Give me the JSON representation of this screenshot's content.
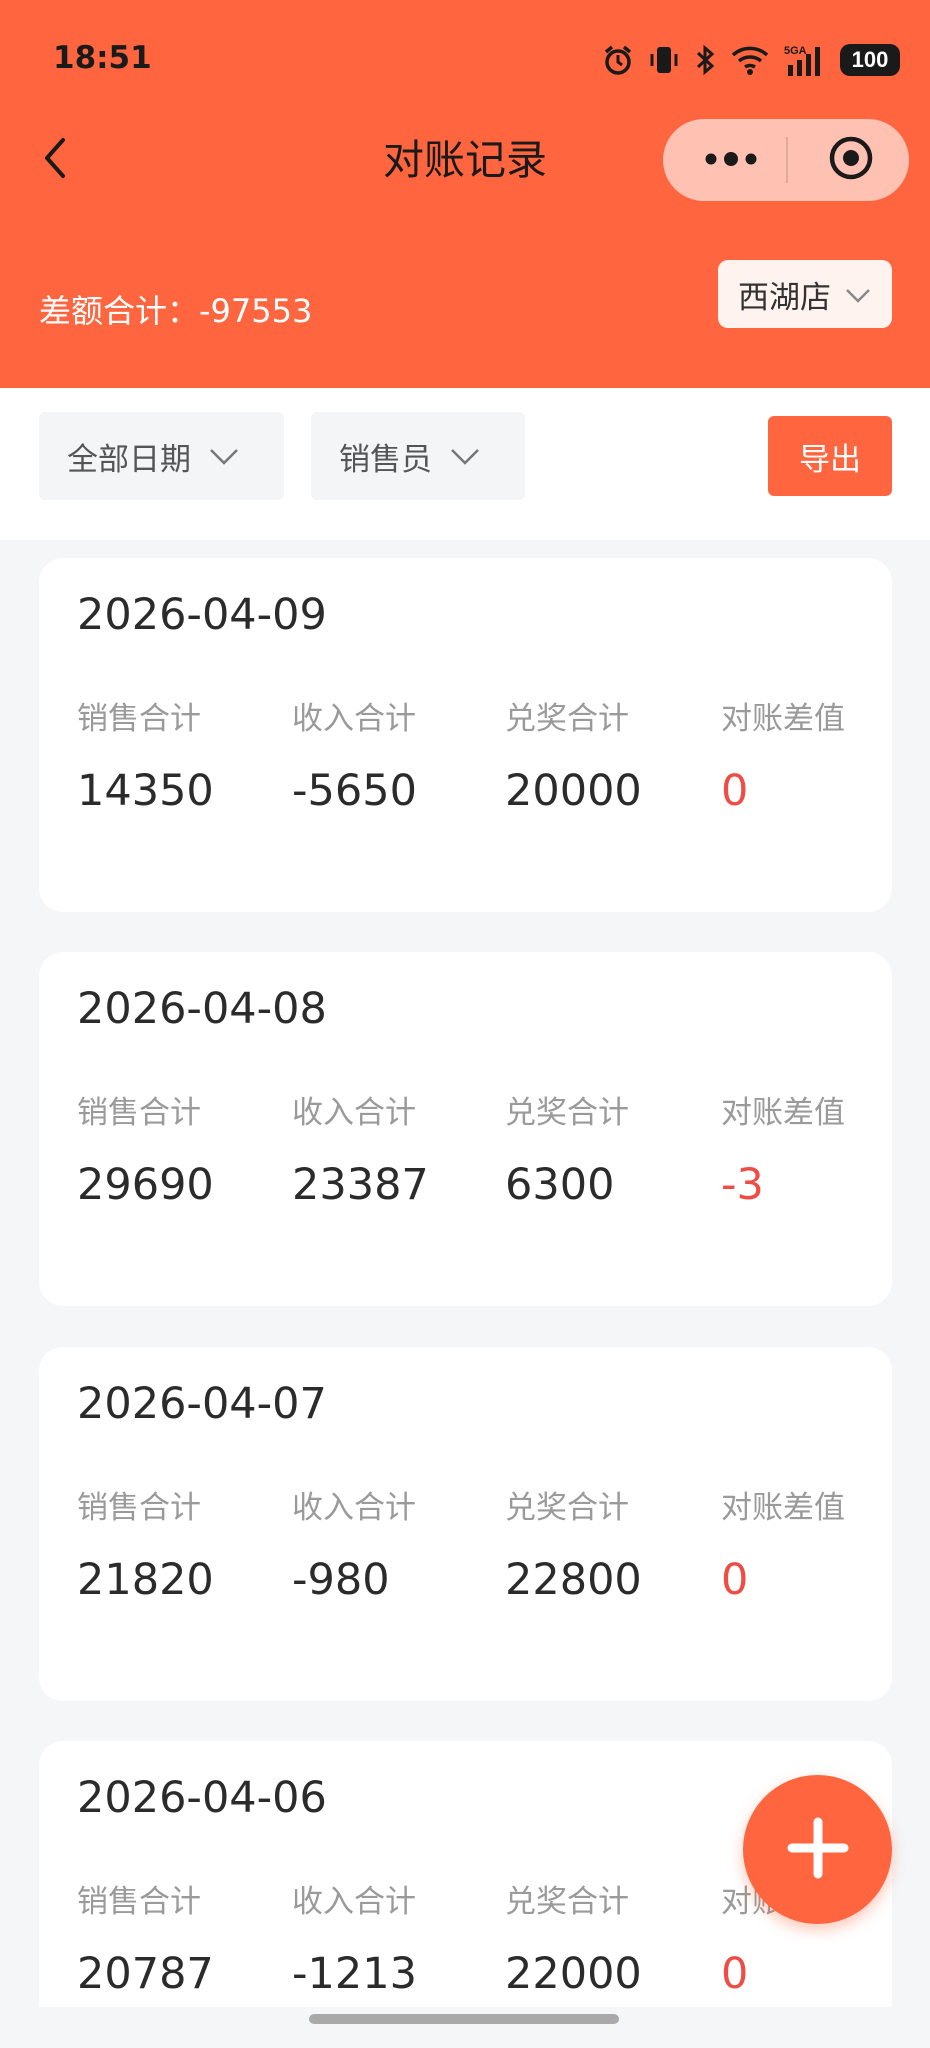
{
  "colors": {
    "brand": "#ff653f",
    "diff": "#ee4c45"
  },
  "status_bar": {
    "time": "18:51",
    "battery": "100",
    "icons": [
      "alarm-icon",
      "vibrate-icon",
      "bluetooth-icon",
      "wifi-icon",
      "signal-5g-icon",
      "battery-icon"
    ]
  },
  "nav": {
    "title": "对账记录",
    "back_icon": "chevron-left-icon",
    "more_icon": "more-dots-icon",
    "close_icon": "target-circle-icon"
  },
  "summary": {
    "diff_total": "差额合计：-97553",
    "store": "西湖店"
  },
  "filters": {
    "date": "全部日期",
    "seller": "销售员",
    "export": "导出"
  },
  "records": [
    {
      "date": "2026-04-09",
      "stats": [
        {
          "label": "销售合计",
          "value": "14350"
        },
        {
          "label": "收入合计",
          "value": "-5650"
        },
        {
          "label": "兑奖合计",
          "value": "20000"
        },
        {
          "label": "对账差值",
          "value": "0"
        }
      ]
    },
    {
      "date": "2026-04-08",
      "stats": [
        {
          "label": "销售合计",
          "value": "29690"
        },
        {
          "label": "收入合计",
          "value": "23387"
        },
        {
          "label": "兑奖合计",
          "value": "6300"
        },
        {
          "label": "对账差值",
          "value": "-3"
        }
      ]
    },
    {
      "date": "2026-04-07",
      "stats": [
        {
          "label": "销售合计",
          "value": "21820"
        },
        {
          "label": "收入合计",
          "value": "-980"
        },
        {
          "label": "兑奖合计",
          "value": "22800"
        },
        {
          "label": "对账差值",
          "value": "0"
        }
      ]
    },
    {
      "date": "2026-04-06",
      "stats": [
        {
          "label": "销售合计",
          "value": "20787"
        },
        {
          "label": "收入合计",
          "value": "-1213"
        },
        {
          "label": "兑奖合计",
          "value": "22000"
        },
        {
          "label": "对账差值",
          "value": "0"
        }
      ]
    }
  ],
  "fab_icon": "plus-icon"
}
